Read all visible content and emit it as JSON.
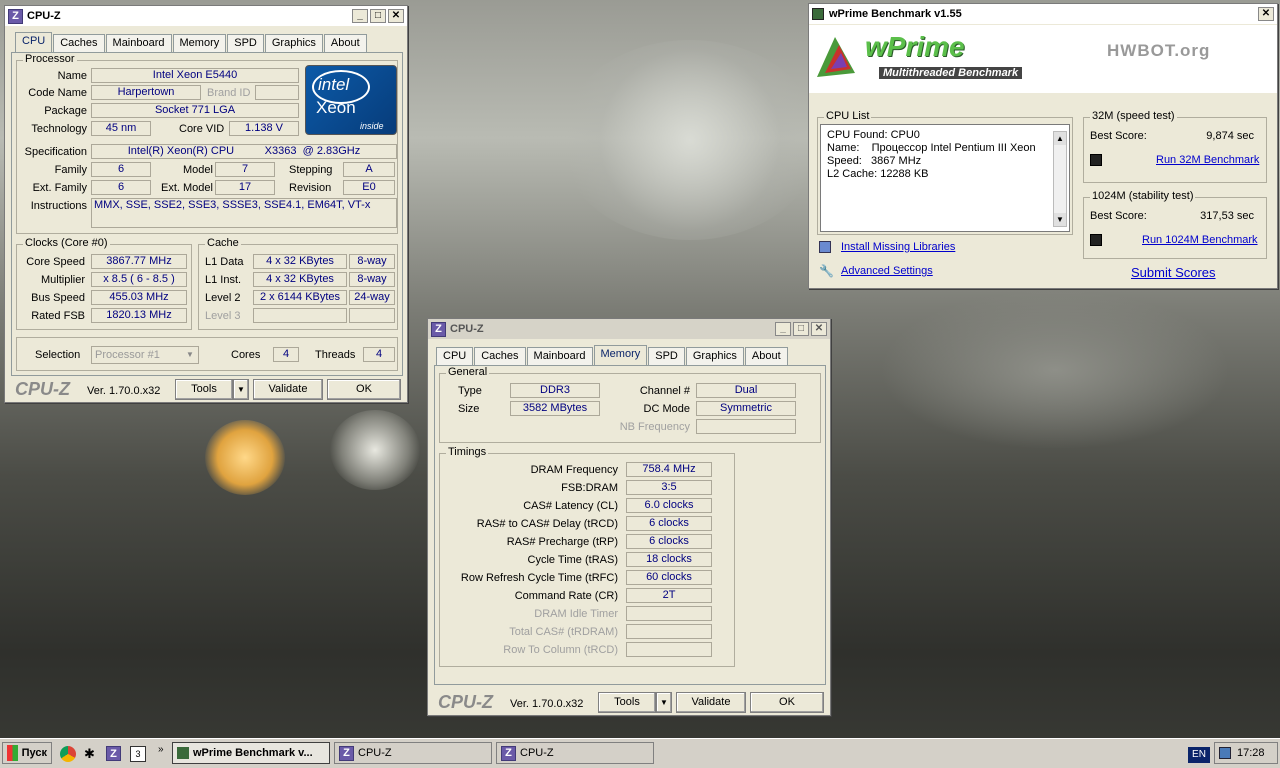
{
  "cpuz1": {
    "title": "CPU-Z",
    "tabs": [
      "CPU",
      "Caches",
      "Mainboard",
      "Memory",
      "SPD",
      "Graphics",
      "About"
    ],
    "processor": {
      "legend": "Processor",
      "name_label": "Name",
      "name": "Intel Xeon E5440",
      "codename_label": "Code Name",
      "codename": "Harpertown",
      "brandid_label": "Brand ID",
      "package_label": "Package",
      "package": "Socket 771 LGA",
      "tech_label": "Technology",
      "tech": "45 nm",
      "corevid_label": "Core VID",
      "corevid": "1.138 V",
      "spec_label": "Specification",
      "spec": "Intel(R) Xeon(R) CPU          X3363  @ 2.83GHz",
      "family_label": "Family",
      "family": "6",
      "model_label": "Model",
      "model": "7",
      "stepping_label": "Stepping",
      "stepping": "A",
      "extfamily_label": "Ext. Family",
      "extfamily": "6",
      "extmodel_label": "Ext. Model",
      "extmodel": "17",
      "revision_label": "Revision",
      "revision": "E0",
      "instr_label": "Instructions",
      "instr": "MMX, SSE, SSE2, SSE3, SSSE3, SSE4.1, EM64T, VT-x"
    },
    "badge": {
      "brand": "intel",
      "product": "Xeon",
      "tag": "inside"
    },
    "clocks": {
      "legend": "Clocks (Core #0)",
      "corespeed_label": "Core Speed",
      "corespeed": "3867.77 MHz",
      "mult_label": "Multiplier",
      "mult": "x 8.5 ( 6 - 8.5 )",
      "bus_label": "Bus Speed",
      "bus": "455.03 MHz",
      "fsb_label": "Rated FSB",
      "fsb": "1820.13 MHz"
    },
    "cache": {
      "legend": "Cache",
      "l1d_label": "L1 Data",
      "l1d": "4 x 32 KBytes",
      "l1d_way": "8-way",
      "l1i_label": "L1 Inst.",
      "l1i": "4 x 32 KBytes",
      "l1i_way": "8-way",
      "l2_label": "Level 2",
      "l2": "2 x 6144 KBytes",
      "l2_way": "24-way",
      "l3_label": "Level 3"
    },
    "selection_label": "Selection",
    "selection": "Processor #1",
    "cores_label": "Cores",
    "cores": "4",
    "threads_label": "Threads",
    "threads": "4",
    "brand": "CPU-Z",
    "version": "Ver. 1.70.0.x32",
    "tools": "Tools",
    "validate": "Validate",
    "ok": "OK"
  },
  "cpuz2": {
    "title": "CPU-Z",
    "tabs": [
      "CPU",
      "Caches",
      "Mainboard",
      "Memory",
      "SPD",
      "Graphics",
      "About"
    ],
    "general": {
      "legend": "General",
      "type_label": "Type",
      "type": "DDR3",
      "size_label": "Size",
      "size": "3582 MBytes",
      "channel_label": "Channel #",
      "channel": "Dual",
      "dcmode_label": "DC Mode",
      "dcmode": "Symmetric",
      "nbfreq_label": "NB Frequency"
    },
    "timings": {
      "legend": "Timings",
      "dram_label": "DRAM Frequency",
      "dram": "758.4 MHz",
      "fsbdram_label": "FSB:DRAM",
      "fsbdram": "3:5",
      "cl_label": "CAS# Latency (CL)",
      "cl": "6.0 clocks",
      "trcd_label": "RAS# to CAS# Delay (tRCD)",
      "trcd": "6 clocks",
      "trp_label": "RAS# Precharge (tRP)",
      "trp": "6 clocks",
      "tras_label": "Cycle Time (tRAS)",
      "tras": "18 clocks",
      "trfc_label": "Row Refresh Cycle Time (tRFC)",
      "trfc": "60 clocks",
      "cr_label": "Command Rate (CR)",
      "cr": "2T",
      "idle_label": "DRAM Idle Timer",
      "totalcas_label": "Total CAS# (tRDRAM)",
      "rowcol_label": "Row To Column (tRCD)"
    },
    "brand": "CPU-Z",
    "version": "Ver. 1.70.0.x32",
    "tools": "Tools",
    "validate": "Validate",
    "ok": "OK"
  },
  "wprime": {
    "title": "wPrime Benchmark v1.55",
    "logo": "wPrime",
    "subtitle": "Multithreaded Benchmark",
    "hwbot": "HWBOT.org",
    "cpulist_legend": "CPU List",
    "cpulist": [
      "CPU Found: CPU0",
      "Name:    Процессор Intel Pentium III Xeon",
      "Speed:   3867 MHz",
      "L2 Cache: 12288 KB"
    ],
    "t32_legend": "32M (speed test)",
    "t32_best_label": "Best Score:",
    "t32_best": "9,874 sec",
    "t32_run": "Run 32M Benchmark",
    "t1024_legend": "1024M (stability test)",
    "t1024_best_label": "Best Score:",
    "t1024_best": "317,53 sec",
    "t1024_run": "Run 1024M Benchmark",
    "install": "Install Missing Libraries",
    "advanced": "Advanced Settings",
    "submit": "Submit Scores"
  },
  "taskbar": {
    "start": "Пуск",
    "items": [
      "wPrime Benchmark v...",
      "CPU-Z",
      "CPU-Z"
    ],
    "lang": "EN",
    "clock": "17:28"
  }
}
